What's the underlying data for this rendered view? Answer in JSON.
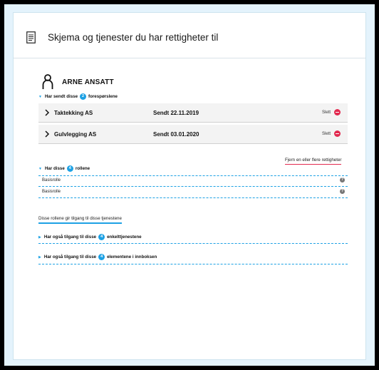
{
  "header": {
    "title": "Skjema og tjenester du har rettigheter til",
    "icon": "document-icon"
  },
  "person": {
    "name": "ARNE ANSATT",
    "icon": "person-icon"
  },
  "requests": {
    "prefix": "Har sendt disse",
    "count": "2",
    "suffix": "forespørslene",
    "items": [
      {
        "company": "Taktekking AS",
        "date": "Sendt 22.11.2019",
        "delete_label": "Slett"
      },
      {
        "company": "Gulvlegging AS",
        "date": "Sendt 03.01.2020",
        "delete_label": "Slett"
      }
    ]
  },
  "remove_link": "Fjern en eller flere rettigheter",
  "roles": {
    "prefix": "Har disse",
    "count": "4",
    "suffix": "rollene",
    "items": [
      {
        "label": "Basisrolle",
        "help": "?"
      },
      {
        "label": "Basisrolle",
        "help": "?"
      }
    ],
    "link": "Disse rollene gir tilgang til disse tjenestene"
  },
  "services": {
    "prefix": "Har også tilgang til disse",
    "count": "4",
    "suffix": "enkelttjenestene"
  },
  "inbox": {
    "prefix": "Har også tilgang til disse",
    "count": "4",
    "suffix": "elementene i innboksen"
  },
  "colors": {
    "accent": "#1da1e4",
    "danger": "#e2294f",
    "background": "#e4f3fc"
  }
}
